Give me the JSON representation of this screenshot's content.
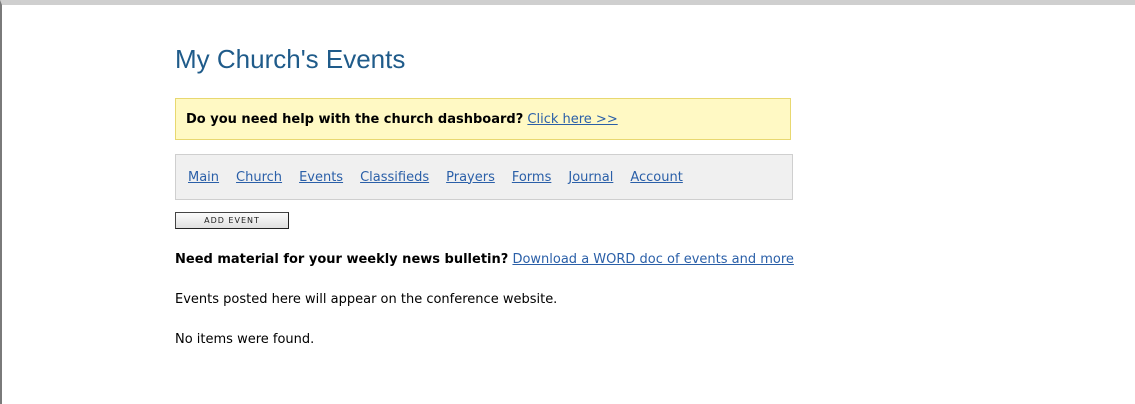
{
  "page": {
    "title": "My Church's Events"
  },
  "help": {
    "question": "Do you need help with the church dashboard?",
    "link_label": "Click here >>"
  },
  "nav": {
    "items": [
      {
        "label": "Main"
      },
      {
        "label": "Church"
      },
      {
        "label": "Events"
      },
      {
        "label": "Classifieds"
      },
      {
        "label": "Prayers"
      },
      {
        "label": "Forms"
      },
      {
        "label": "Journal"
      },
      {
        "label": "Account"
      }
    ]
  },
  "actions": {
    "add_event_label": "ADD EVENT"
  },
  "bulletin": {
    "question": "Need material for your weekly news bulletin?",
    "link_label": "Download a WORD doc of events and more"
  },
  "messages": {
    "conference_note": "Events posted here will appear on the conference website.",
    "empty_state": "No items were found."
  }
}
